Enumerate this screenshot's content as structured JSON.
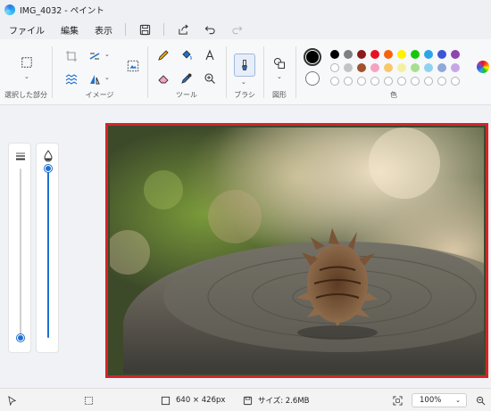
{
  "window": {
    "title": "IMG_4032 - ペイント"
  },
  "menu": {
    "file": "ファイル",
    "edit": "編集",
    "view": "表示"
  },
  "ribbon": {
    "selection_label": "選択した部分",
    "image_label": "イメージ",
    "tools_label": "ツール",
    "brushes_label": "ブラシ",
    "shapes_label": "図形",
    "colors_label": "色"
  },
  "colors": {
    "primary": "#000000",
    "secondary": "#ffffff",
    "palette_row1": [
      "#000000",
      "#7f7f7f",
      "#8b1a1a",
      "#e81123",
      "#f7630c",
      "#fff100",
      "#16c60c",
      "#2aa5e8",
      "#3b57d4",
      "#8e44ad"
    ],
    "palette_row2": [
      "#ffffff",
      "#c3c3c3",
      "#a0522d",
      "#f4a3c0",
      "#f9c76a",
      "#f5f0a0",
      "#a7e08e",
      "#8fd2f0",
      "#8fa8d9",
      "#c7a6e6"
    ],
    "accent": "#1f6fce",
    "selection_border": "#d4242a"
  },
  "sliders": {
    "size_level": 0.0,
    "opacity_level": 1.0
  },
  "status": {
    "dimensions": "640 × 426px",
    "file_size": "サイズ: 2.6MB",
    "zoom": "100%"
  }
}
